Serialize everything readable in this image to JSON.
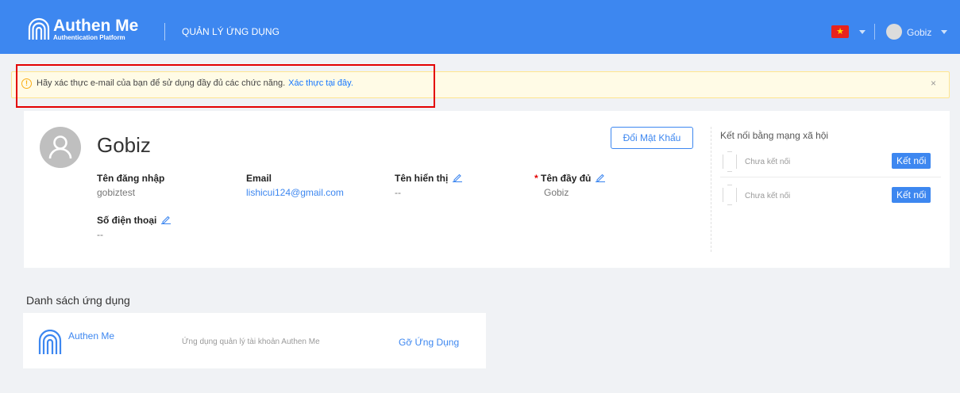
{
  "header": {
    "brand_name": "Authen Me",
    "brand_tagline": "Authentication Platform",
    "nav_item": "QUẢN LÝ ỨNG DỤNG",
    "user_name": "Gobiz",
    "flag_icon": "vietnam-flag-icon",
    "bg_color": "#3d87f0"
  },
  "alert": {
    "message": "Hãy xác thực e-mail của bạn để sử dụng đầy đủ các chức năng.",
    "link_text": "Xác thực tại đây.",
    "close_symbol": "×",
    "icon_symbol": "!"
  },
  "profile": {
    "display_name": "Gobiz",
    "change_password_label": "Đổi Mật Khẩu",
    "fields": {
      "username": {
        "label": "Tên đăng nhập",
        "value": "gobiztest"
      },
      "email": {
        "label": "Email",
        "value": "lishicui124@gmail.com"
      },
      "display": {
        "label": "Tên hiển thị",
        "value": "--"
      },
      "fullname": {
        "required_mark": "*",
        "label": "Tên đầy đủ",
        "value": "Gobiz"
      },
      "phone": {
        "label": "Số điện thoại",
        "value": "--"
      }
    }
  },
  "social": {
    "title": "Kết nối bằng mạng xã hội",
    "items": [
      {
        "status": "Chưa kết nối",
        "button": "Kết nối"
      },
      {
        "status": "Chưa kết nối",
        "button": "Kết nối"
      }
    ]
  },
  "apps": {
    "title": "Danh sách ứng dụng",
    "items": [
      {
        "name": "Authen Me",
        "description": "Ứng dụng quản lý tài khoản Authen Me",
        "action": "Gỡ Ứng Dụng"
      }
    ]
  }
}
